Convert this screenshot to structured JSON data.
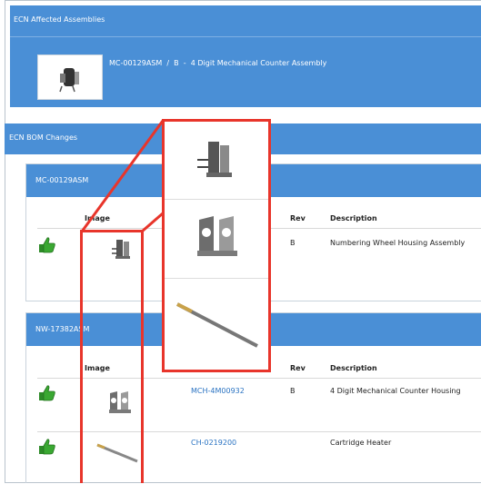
{
  "affected": {
    "title": "ECN Affected Assemblies",
    "item": {
      "part": "MC-00129ASM",
      "sep1": "/",
      "rev": "B",
      "sep2": "-",
      "desc": "4 Digit Mechanical Counter Assembly"
    }
  },
  "bom": {
    "title": "ECN BOM Changes",
    "groups": [
      {
        "title": "MC-00129ASM",
        "headers": {
          "image": "Image",
          "rev": "Rev",
          "description": "Description"
        },
        "rows": [
          {
            "part": "",
            "rev": "B",
            "description": "Numbering Wheel Housing Assembly"
          }
        ]
      },
      {
        "title": "NW-17382ASM",
        "headers": {
          "image": "Image",
          "rev": "Rev",
          "description": "Description"
        },
        "rows": [
          {
            "part": "MCH-4M00932",
            "rev": "B",
            "description": "4 Digit Mechanical Counter Housing"
          },
          {
            "part": "CH-0219200",
            "rev": "",
            "description": "Cartridge Heater"
          }
        ]
      }
    ]
  },
  "colors": {
    "header_blue": "#4a8fd6",
    "highlight_red": "#e8352b",
    "thumb_green": "#3aa832",
    "link_blue": "#2a73c2"
  },
  "icons": [
    "thumbs-up-icon",
    "counter-assembly-image",
    "housing-assembly-image",
    "housing-image",
    "heater-rod-image"
  ]
}
